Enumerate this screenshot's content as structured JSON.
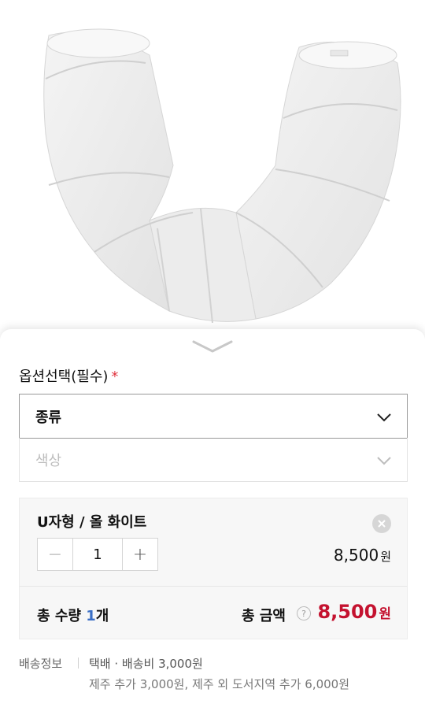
{
  "product_image": {
    "alt": "U-shaped white tunnel product photo"
  },
  "option_panel": {
    "title": "옵션선택(필수)",
    "required_mark": "*",
    "select_type": {
      "label": "종류",
      "state": "active"
    },
    "select_color": {
      "label": "색상",
      "state": "disabled"
    }
  },
  "selected_item": {
    "name": "U자형 / 올 화이트",
    "quantity": "1",
    "decrement": "−",
    "increment": "+",
    "price": "8,500",
    "price_unit": "원"
  },
  "totals": {
    "qty_label_prefix": "총 수량 ",
    "qty_value": "1",
    "qty_suffix": "개",
    "amount_label": "총 금액",
    "help": "?",
    "amount": "8,500",
    "amount_unit": "원"
  },
  "shipping": {
    "label": "배송정보",
    "main": "택배 · 배송비 3,000원",
    "extra": "제주 추가 3,000원, 제주 외 도서지역 추가 6,000원"
  },
  "colors": {
    "accent_red": "#c4122f",
    "qty_blue": "#3a6fc6",
    "required_red": "#e0333e"
  }
}
